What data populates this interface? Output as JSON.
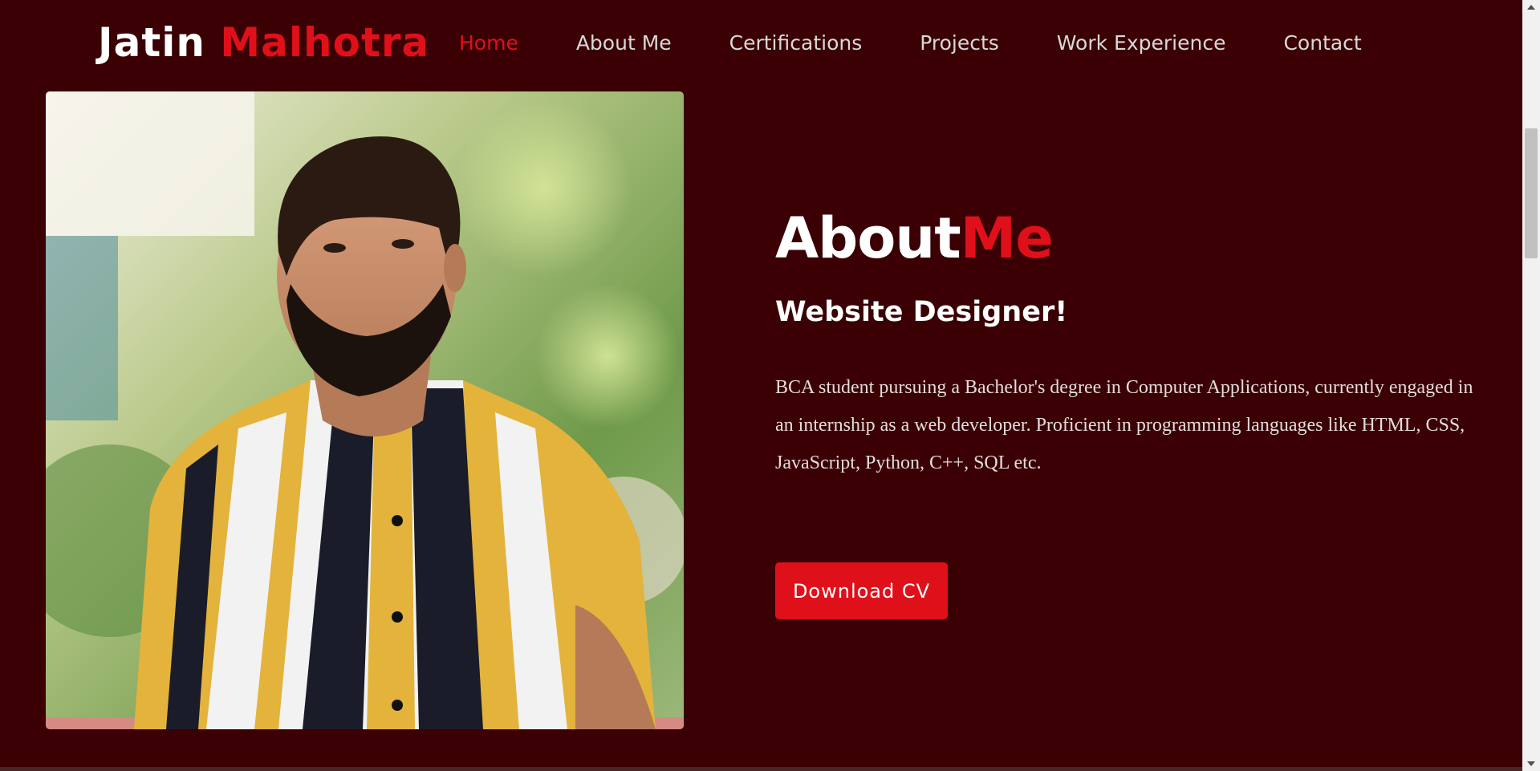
{
  "header": {
    "logo_first": "Jatin",
    "logo_last": "Malhotra"
  },
  "nav": {
    "items": [
      {
        "label": "Home",
        "active": true
      },
      {
        "label": "About Me",
        "active": false
      },
      {
        "label": "Certifications",
        "active": false
      },
      {
        "label": "Projects",
        "active": false
      },
      {
        "label": "Work Experience",
        "active": false
      },
      {
        "label": "Contact",
        "active": false
      }
    ]
  },
  "about": {
    "heading_white": "About",
    "heading_red": "Me",
    "subtitle": "Website Designer!",
    "description": "BCA student pursuing a Bachelor's degree in Computer Applications, currently engaged in an internship as a web developer. Proficient in programming languages like HTML, CSS, JavaScript, Python, C++, SQL etc.",
    "cv_button": "Download CV"
  },
  "colors": {
    "background": "#3a0003",
    "accent": "#e0101a",
    "text": "#ffffff"
  },
  "icons": {
    "scroll_up": "triangle-up-icon",
    "scroll_down": "triangle-down-icon"
  }
}
